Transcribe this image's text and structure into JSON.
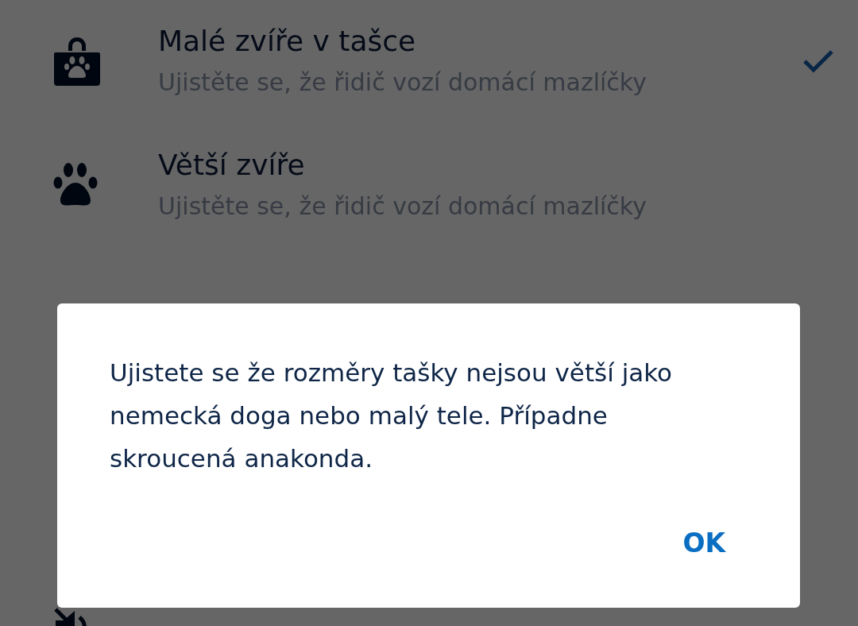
{
  "options": [
    {
      "kind": "bag",
      "title": "Malé zvíře v tašce",
      "subtitle": "Ujistěte se, že řidič vozí domácí mazlíčky",
      "selected": true
    },
    {
      "kind": "paw",
      "title": "Větší zvíře",
      "subtitle": "Ujistěte se, že řidič vozí domácí mazlíčky",
      "selected": false
    },
    {
      "kind": "muted"
    }
  ],
  "dialog": {
    "message": "Ujistete se že rozměry tašky nejsou větší jako nemecká doga nebo malý tele. Případne skroucená anakonda.",
    "button": "OK"
  }
}
